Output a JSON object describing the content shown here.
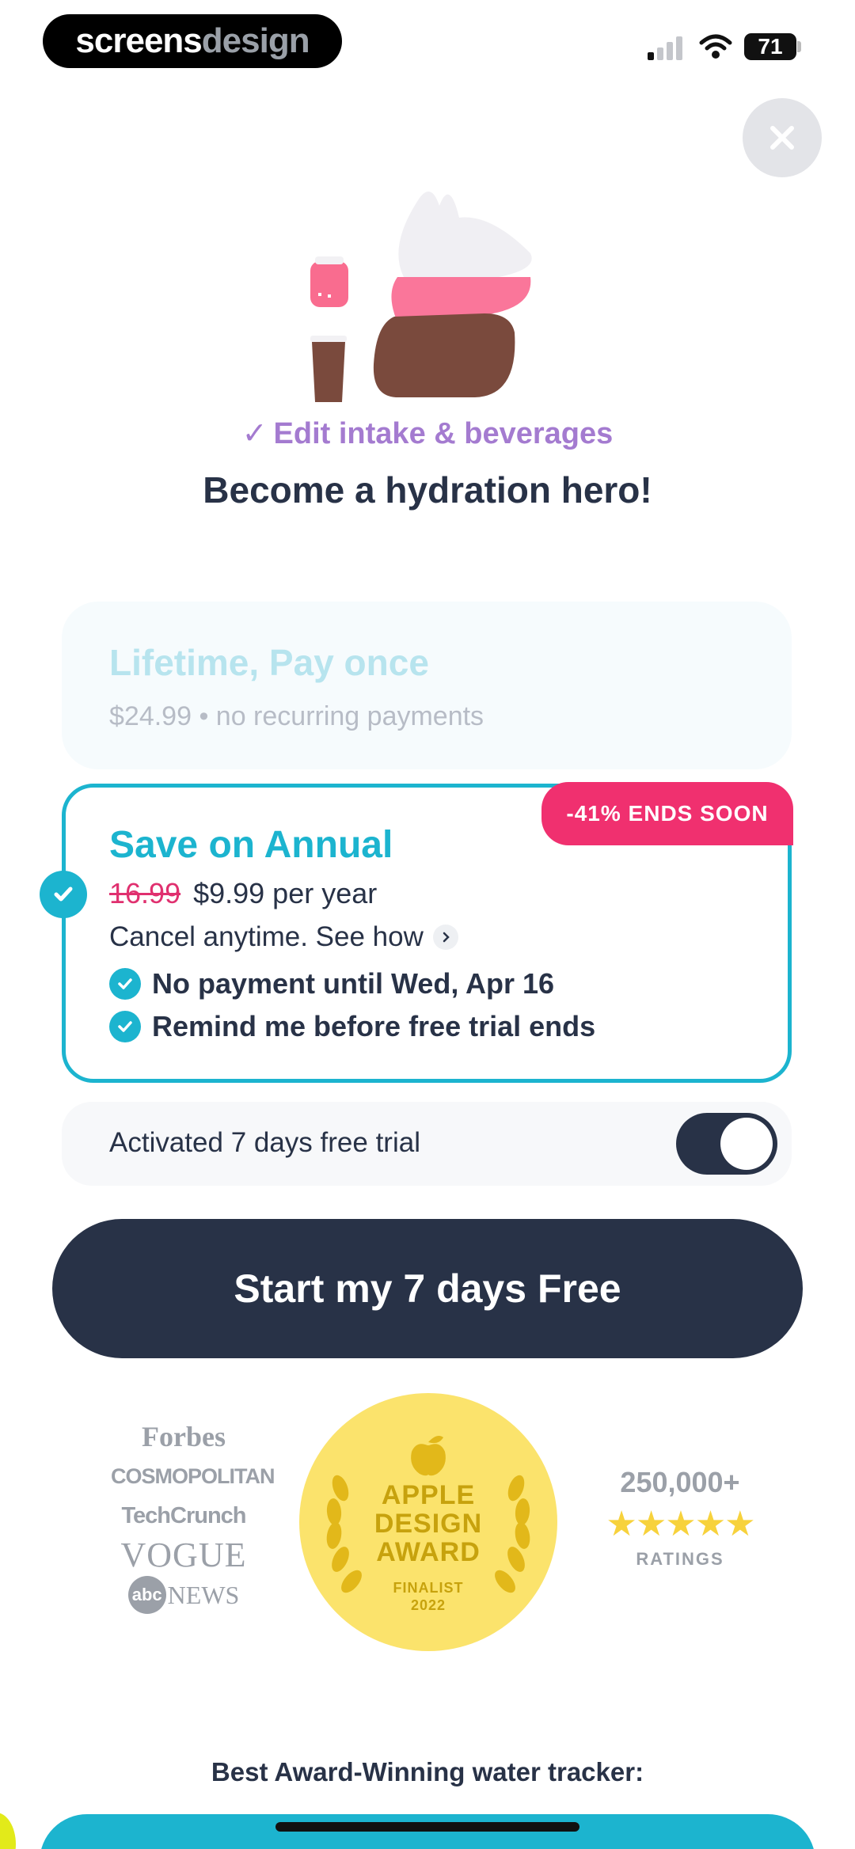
{
  "status_bar": {
    "brand_part1": "screens",
    "brand_part2": "design",
    "battery": "71"
  },
  "close_icon": "close-icon",
  "feature_line": "Edit intake & beverages",
  "headline": "Become a hydration hero!",
  "plans": {
    "lifetime": {
      "title": "Lifetime, Pay once",
      "subtitle": "$24.99 • no recurring payments"
    },
    "annual": {
      "badge": "-41% ENDS SOON",
      "title": "Save on Annual",
      "old_price": "16.99",
      "price": "$9.99 per year",
      "cancel_text": "Cancel anytime. See how",
      "benefits": [
        "No payment until Wed, Apr 16",
        "Remind me before free trial ends"
      ]
    }
  },
  "trial": {
    "label": "Activated 7 days free trial",
    "enabled": true
  },
  "cta": "Start my 7 days Free",
  "press": {
    "forbes": "Forbes",
    "cosmopolitan": "COSMOPOLITAN",
    "techcrunch": "TechCrunch",
    "vogue": "VOGUE",
    "abc": "abc",
    "news": "NEWS"
  },
  "award": {
    "line1": "APPLE",
    "line2": "DESIGN",
    "line3": "AWARD",
    "line4": "FINALIST",
    "line5": "2022"
  },
  "ratings": {
    "count": "250,000+",
    "stars": "★★★★★",
    "label": "RATINGS",
    "value": 5
  },
  "footer_text": "Best Award-Winning water tracker:",
  "colors": {
    "accent": "#1cb4cf",
    "navy": "#283247",
    "pink": "#f0306f",
    "purple": "#a47bd0",
    "gold": "#fbe36c"
  }
}
